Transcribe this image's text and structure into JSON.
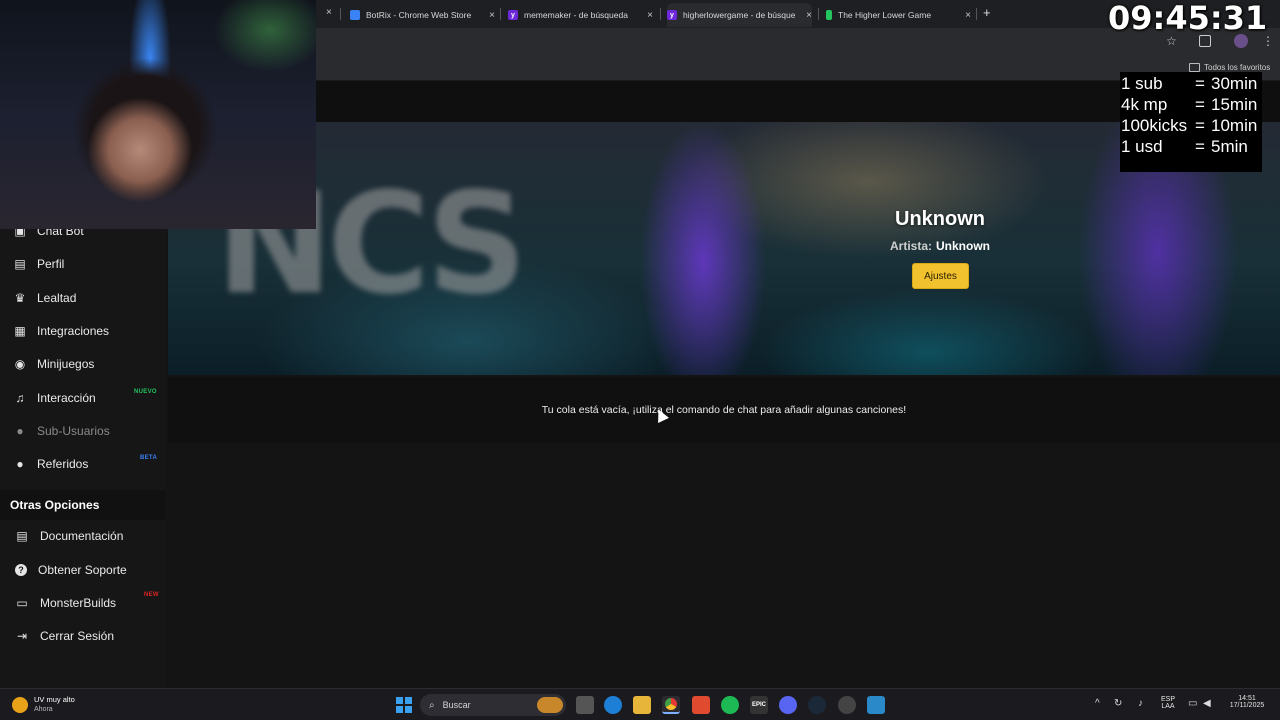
{
  "browser": {
    "tabs": [
      {
        "title": "BotRix - Chrome Web Store",
        "color": "#3b82f6"
      },
      {
        "title": "mememaker - de búsqueda",
        "color": "#6d28d9"
      },
      {
        "title": "higherlowergame - de búsqued",
        "color": "#6d28d9"
      },
      {
        "title": "The Higher Lower Game",
        "color": "#22c55e"
      }
    ],
    "close_glyph": "×",
    "new_tab_glyph": "+",
    "bookmarks_label": "Todos los favoritos"
  },
  "sidebar": {
    "items": [
      {
        "label": "Chat Bot",
        "icon": "robot-icon",
        "glyph": "▣"
      },
      {
        "label": "Perfil",
        "icon": "profile-card-icon",
        "glyph": "▤"
      },
      {
        "label": "Lealtad",
        "icon": "trophy-icon",
        "glyph": "🏆"
      },
      {
        "label": "Integraciones",
        "icon": "integration-icon",
        "glyph": "▦"
      },
      {
        "label": "Minijuegos",
        "icon": "gamepad-icon",
        "glyph": "◉"
      },
      {
        "label": "Interacción",
        "icon": "music-icon",
        "glyph": "♫",
        "badge": "NUEVO",
        "badge_color": "#22c55e"
      },
      {
        "label": "Sub-Usuarios",
        "icon": "users-icon",
        "glyph": "●",
        "dim": true
      },
      {
        "label": "Referidos",
        "icon": "user-group-icon",
        "glyph": "●",
        "badge": "BETA",
        "badge_color": "#3b82f6"
      }
    ],
    "section_title": "Otras Opciones",
    "other": [
      {
        "label": "Documentación",
        "icon": "document-icon",
        "glyph": "▤"
      },
      {
        "label": "Obtener Soporte",
        "icon": "help-circle-icon",
        "glyph": "?"
      },
      {
        "label": "MonsterBuilds",
        "icon": "laptop-icon",
        "glyph": "▭",
        "badge": "NEW",
        "badge_color": "#dc2626"
      },
      {
        "label": "Cerrar Sesión",
        "icon": "logout-icon",
        "glyph": "⇥"
      }
    ]
  },
  "player": {
    "title": "Unknown",
    "artist_label": "Artista:",
    "artist": "Unknown",
    "settings_button": "Ajustes",
    "artwork_text": "NCS"
  },
  "queue": {
    "empty_message": "Tu cola está vacía, ¡utiliza el comando de chat para añadir algunas canciones!"
  },
  "stream_overlay": {
    "timer": "09:45:31",
    "rates": [
      {
        "key": "1 sub",
        "value": "30min"
      },
      {
        "key": "4k mp",
        "value": "15min"
      },
      {
        "key": "100kicks",
        "value": "10min"
      },
      {
        "key": "1 usd",
        "value": "5min"
      }
    ],
    "equals": "="
  },
  "taskbar": {
    "weather_title": "UV muy alto",
    "weather_sub": "Ahora",
    "search_placeholder": "Buscar",
    "lang_top": "ESP",
    "lang_bottom": "LAA",
    "time": "14:51",
    "date": "17/11/2025"
  }
}
